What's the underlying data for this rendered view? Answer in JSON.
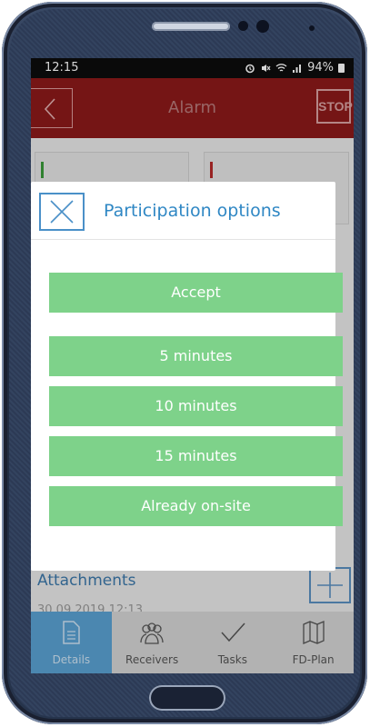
{
  "status_bar": {
    "time": "12:15",
    "battery": "94%"
  },
  "app_bar": {
    "title": "Alarm",
    "stop_label": "STOP"
  },
  "background": {
    "attachments_title": "Attachments",
    "attachment_date": "30.09.2019 12:13"
  },
  "tabs": [
    {
      "label": "Details",
      "icon": "document-icon",
      "active": true
    },
    {
      "label": "Receivers",
      "icon": "users-icon",
      "active": false
    },
    {
      "label": "Tasks",
      "icon": "checkmark-icon",
      "active": false
    },
    {
      "label": "FD-Plan",
      "icon": "map-icon",
      "active": false
    }
  ],
  "dialog": {
    "title": "Participation options",
    "options": [
      "Accept",
      "5 minutes",
      "10 minutes",
      "15 minutes",
      "Already on-site"
    ]
  },
  "colors": {
    "app_bar": "#8c1a1a",
    "option_button": "#7ed28a",
    "accent_blue": "#2f87c4",
    "active_tab": "#5aa1d2"
  }
}
